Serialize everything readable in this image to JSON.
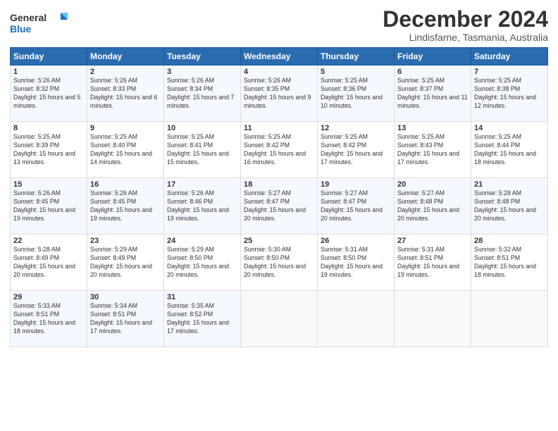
{
  "header": {
    "logo_line1": "General",
    "logo_line2": "Blue",
    "month_year": "December 2024",
    "location": "Lindisfarne, Tasmania, Australia"
  },
  "days_of_week": [
    "Sunday",
    "Monday",
    "Tuesday",
    "Wednesday",
    "Thursday",
    "Friday",
    "Saturday"
  ],
  "weeks": [
    [
      {
        "day": "1",
        "sunrise": "Sunrise: 5:26 AM",
        "sunset": "Sunset: 8:32 PM",
        "daylight": "Daylight: 15 hours and 5 minutes."
      },
      {
        "day": "2",
        "sunrise": "Sunrise: 5:26 AM",
        "sunset": "Sunset: 8:33 PM",
        "daylight": "Daylight: 15 hours and 6 minutes."
      },
      {
        "day": "3",
        "sunrise": "Sunrise: 5:26 AM",
        "sunset": "Sunset: 8:34 PM",
        "daylight": "Daylight: 15 hours and 7 minutes."
      },
      {
        "day": "4",
        "sunrise": "Sunrise: 5:26 AM",
        "sunset": "Sunset: 8:35 PM",
        "daylight": "Daylight: 15 hours and 9 minutes."
      },
      {
        "day": "5",
        "sunrise": "Sunrise: 5:25 AM",
        "sunset": "Sunset: 8:36 PM",
        "daylight": "Daylight: 15 hours and 10 minutes."
      },
      {
        "day": "6",
        "sunrise": "Sunrise: 5:25 AM",
        "sunset": "Sunset: 8:37 PM",
        "daylight": "Daylight: 15 hours and 11 minutes."
      },
      {
        "day": "7",
        "sunrise": "Sunrise: 5:25 AM",
        "sunset": "Sunset: 8:38 PM",
        "daylight": "Daylight: 15 hours and 12 minutes."
      }
    ],
    [
      {
        "day": "8",
        "sunrise": "Sunrise: 5:25 AM",
        "sunset": "Sunset: 8:39 PM",
        "daylight": "Daylight: 15 hours and 13 minutes."
      },
      {
        "day": "9",
        "sunrise": "Sunrise: 5:25 AM",
        "sunset": "Sunset: 8:40 PM",
        "daylight": "Daylight: 15 hours and 14 minutes."
      },
      {
        "day": "10",
        "sunrise": "Sunrise: 5:25 AM",
        "sunset": "Sunset: 8:41 PM",
        "daylight": "Daylight: 15 hours and 15 minutes."
      },
      {
        "day": "11",
        "sunrise": "Sunrise: 5:25 AM",
        "sunset": "Sunset: 8:42 PM",
        "daylight": "Daylight: 15 hours and 16 minutes."
      },
      {
        "day": "12",
        "sunrise": "Sunrise: 5:25 AM",
        "sunset": "Sunset: 8:42 PM",
        "daylight": "Daylight: 15 hours and 17 minutes."
      },
      {
        "day": "13",
        "sunrise": "Sunrise: 5:25 AM",
        "sunset": "Sunset: 8:43 PM",
        "daylight": "Daylight: 15 hours and 17 minutes."
      },
      {
        "day": "14",
        "sunrise": "Sunrise: 5:25 AM",
        "sunset": "Sunset: 8:44 PM",
        "daylight": "Daylight: 15 hours and 18 minutes."
      }
    ],
    [
      {
        "day": "15",
        "sunrise": "Sunrise: 5:26 AM",
        "sunset": "Sunset: 8:45 PM",
        "daylight": "Daylight: 15 hours and 19 minutes."
      },
      {
        "day": "16",
        "sunrise": "Sunrise: 5:26 AM",
        "sunset": "Sunset: 8:45 PM",
        "daylight": "Daylight: 15 hours and 19 minutes."
      },
      {
        "day": "17",
        "sunrise": "Sunrise: 5:26 AM",
        "sunset": "Sunset: 8:46 PM",
        "daylight": "Daylight: 15 hours and 19 minutes."
      },
      {
        "day": "18",
        "sunrise": "Sunrise: 5:27 AM",
        "sunset": "Sunset: 8:47 PM",
        "daylight": "Daylight: 15 hours and 20 minutes."
      },
      {
        "day": "19",
        "sunrise": "Sunrise: 5:27 AM",
        "sunset": "Sunset: 8:47 PM",
        "daylight": "Daylight: 15 hours and 20 minutes."
      },
      {
        "day": "20",
        "sunrise": "Sunrise: 5:27 AM",
        "sunset": "Sunset: 8:48 PM",
        "daylight": "Daylight: 15 hours and 20 minutes."
      },
      {
        "day": "21",
        "sunrise": "Sunrise: 5:28 AM",
        "sunset": "Sunset: 8:48 PM",
        "daylight": "Daylight: 15 hours and 20 minutes."
      }
    ],
    [
      {
        "day": "22",
        "sunrise": "Sunrise: 5:28 AM",
        "sunset": "Sunset: 8:49 PM",
        "daylight": "Daylight: 15 hours and 20 minutes."
      },
      {
        "day": "23",
        "sunrise": "Sunrise: 5:29 AM",
        "sunset": "Sunset: 8:49 PM",
        "daylight": "Daylight: 15 hours and 20 minutes."
      },
      {
        "day": "24",
        "sunrise": "Sunrise: 5:29 AM",
        "sunset": "Sunset: 8:50 PM",
        "daylight": "Daylight: 15 hours and 20 minutes."
      },
      {
        "day": "25",
        "sunrise": "Sunrise: 5:30 AM",
        "sunset": "Sunset: 8:50 PM",
        "daylight": "Daylight: 15 hours and 20 minutes."
      },
      {
        "day": "26",
        "sunrise": "Sunrise: 5:31 AM",
        "sunset": "Sunset: 8:50 PM",
        "daylight": "Daylight: 15 hours and 19 minutes."
      },
      {
        "day": "27",
        "sunrise": "Sunrise: 5:31 AM",
        "sunset": "Sunset: 8:51 PM",
        "daylight": "Daylight: 15 hours and 19 minutes."
      },
      {
        "day": "28",
        "sunrise": "Sunrise: 5:32 AM",
        "sunset": "Sunset: 8:51 PM",
        "daylight": "Daylight: 15 hours and 18 minutes."
      }
    ],
    [
      {
        "day": "29",
        "sunrise": "Sunrise: 5:33 AM",
        "sunset": "Sunset: 8:51 PM",
        "daylight": "Daylight: 15 hours and 18 minutes."
      },
      {
        "day": "30",
        "sunrise": "Sunrise: 5:34 AM",
        "sunset": "Sunset: 8:51 PM",
        "daylight": "Daylight: 15 hours and 17 minutes."
      },
      {
        "day": "31",
        "sunrise": "Sunrise: 5:35 AM",
        "sunset": "Sunset: 8:52 PM",
        "daylight": "Daylight: 15 hours and 17 minutes."
      },
      null,
      null,
      null,
      null
    ]
  ]
}
